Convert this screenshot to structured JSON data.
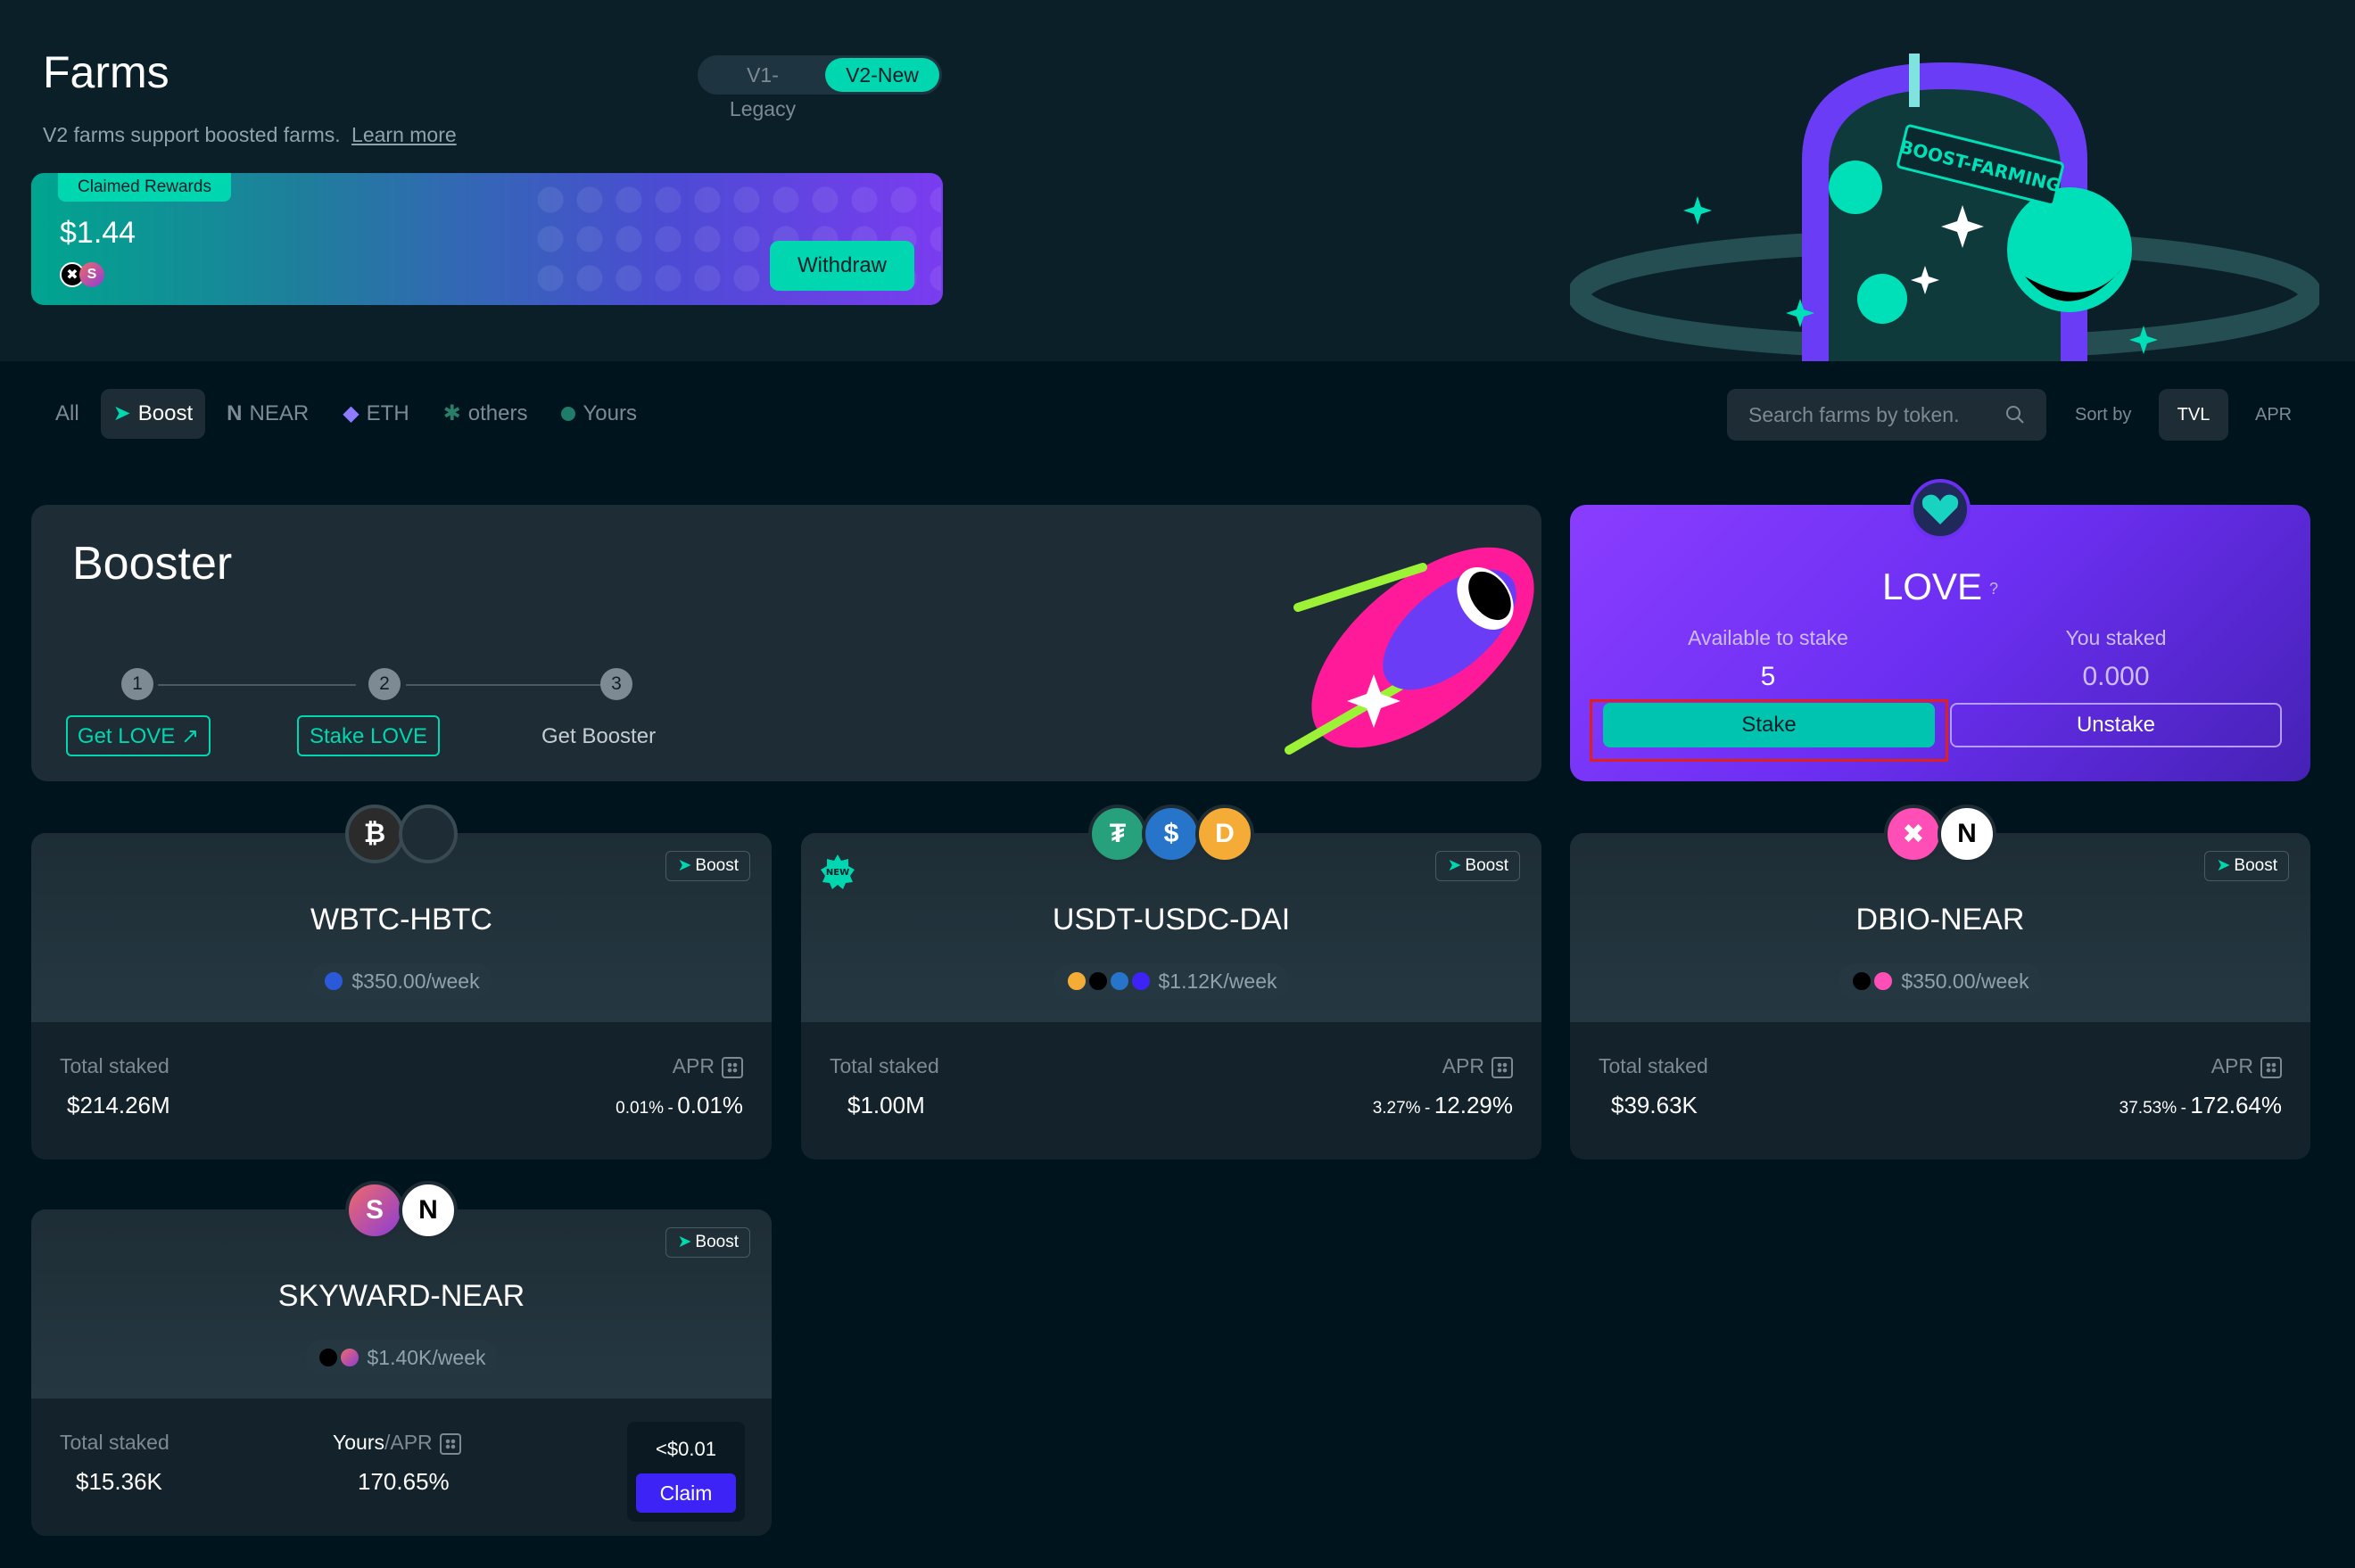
{
  "header": {
    "title": "Farms",
    "version_toggle": {
      "v1": "V1-Legacy",
      "v2": "V2-New",
      "selected": "V2-New"
    },
    "subtitle": "V2 farms support boosted farms.",
    "learn_more": "Learn more"
  },
  "rewards": {
    "badge": "Claimed Rewards",
    "value": "$1.44",
    "withdraw_label": "Withdraw",
    "tokens": [
      "ref-icon",
      "skyward-icon"
    ]
  },
  "hero": {
    "sign_text": "BOOST-FARMING"
  },
  "filters": {
    "items": [
      {
        "label": "All",
        "icon": ""
      },
      {
        "label": "Boost",
        "icon": "rocket-icon"
      },
      {
        "label": "NEAR",
        "icon": "near-icon"
      },
      {
        "label": "ETH",
        "icon": "eth-icon"
      },
      {
        "label": "others",
        "icon": "others-icon"
      },
      {
        "label": "Yours",
        "icon": "yours-icon"
      }
    ],
    "active": "Boost"
  },
  "search": {
    "placeholder": "Search farms by token."
  },
  "sort": {
    "label": "Sort by",
    "options": [
      "TVL",
      "APR"
    ],
    "selected": "TVL"
  },
  "booster": {
    "title": "Booster",
    "steps": [
      {
        "num": "1",
        "label": "Get LOVE ↗"
      },
      {
        "num": "2",
        "label": "Stake LOVE"
      },
      {
        "num": "3",
        "label": "Get Booster"
      }
    ]
  },
  "love": {
    "title": "LOVE",
    "help": "?",
    "available_label": "Available to stake",
    "available_value": "5",
    "staked_label": "You staked",
    "staked_value": "0.000",
    "stake_label": "Stake",
    "unstake_label": "Unstake"
  },
  "farms": [
    {
      "name": "WBTC-HBTC",
      "boost": "Boost",
      "reward": "$350.00/week",
      "total_staked_label": "Total staked",
      "total_staked": "$214.26M",
      "apr_label": "APR",
      "apr_min": "0.01%",
      "apr_max": "0.01%",
      "sep": "-"
    },
    {
      "name": "USDT-USDC-DAI",
      "boost": "Boost",
      "new_badge": "NEW",
      "reward": "$1.12K/week",
      "total_staked_label": "Total staked",
      "total_staked": "$1.00M",
      "apr_label": "APR",
      "apr_min": "3.27%",
      "apr_max": "12.29%",
      "sep": "-"
    },
    {
      "name": "DBIO-NEAR",
      "boost": "Boost",
      "reward": "$350.00/week",
      "total_staked_label": "Total staked",
      "total_staked": "$39.63K",
      "apr_label": "APR",
      "apr_min": "37.53%",
      "apr_max": "172.64%",
      "sep": "-"
    },
    {
      "name": "SKYWARD-NEAR",
      "boost": "Boost",
      "reward": "$1.40K/week",
      "total_staked_label": "Total staked",
      "total_staked": "$15.36K",
      "yours_label": "Yours",
      "apr_label": "/APR",
      "apr_value": "170.65%",
      "claim_amount": "<$0.01",
      "claim_label": "Claim"
    }
  ],
  "colors": {
    "accent": "#00d6af",
    "background": "#00141e",
    "card": "#1e2d35",
    "love_purple": "#6c2ff2",
    "claim_blue": "#3d23f5",
    "highlight_red": "#e02020"
  }
}
